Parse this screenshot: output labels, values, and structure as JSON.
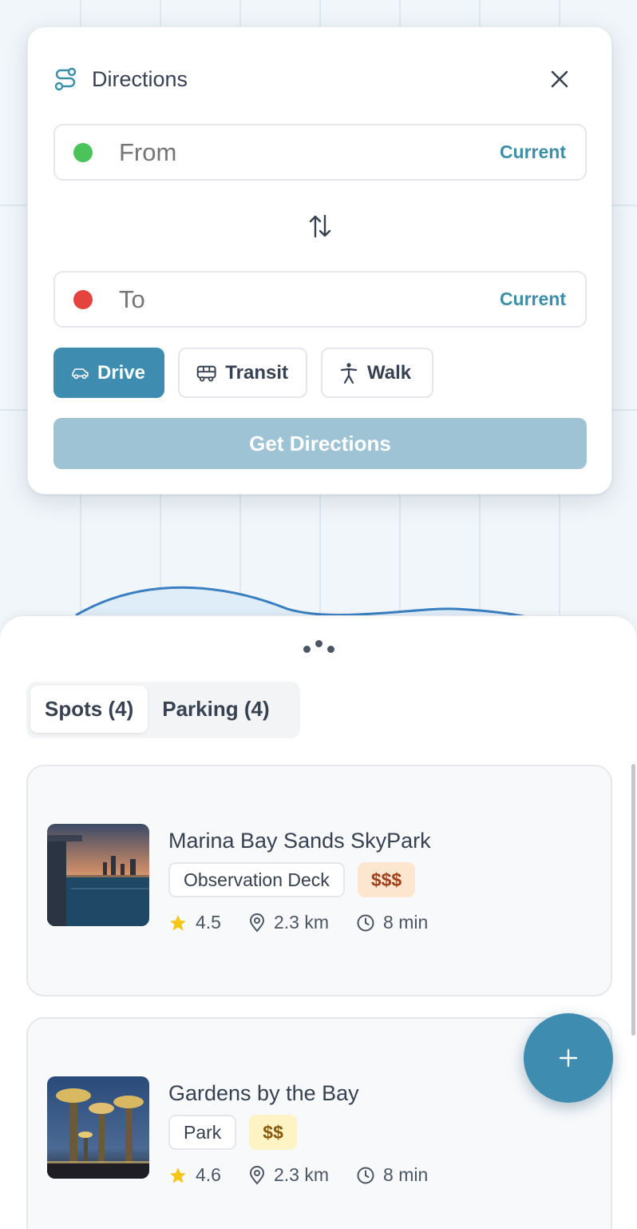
{
  "directions": {
    "title": "Directions",
    "from": {
      "placeholder": "From",
      "current_label": "Current",
      "dot_color": "#4cc35a"
    },
    "to": {
      "placeholder": "To",
      "current_label": "Current",
      "dot_color": "#e5443e"
    },
    "modes": [
      {
        "label": "Drive",
        "icon": "car-icon",
        "active": true
      },
      {
        "label": "Transit",
        "icon": "bus-icon",
        "active": false
      },
      {
        "label": "Walk",
        "icon": "walk-icon",
        "active": false
      }
    ],
    "get_directions_label": "Get Directions"
  },
  "sheet": {
    "tabs": [
      {
        "label": "Spots (4)",
        "active": true
      },
      {
        "label": "Parking (4)",
        "active": false
      }
    ],
    "spots": [
      {
        "name": "Marina Bay Sands SkyPark",
        "category": "Observation Deck",
        "price": "$$$",
        "price_bg": "#fde6d0",
        "price_color": "#a0401a",
        "rating": "4.5",
        "distance": "2.3 km",
        "time": "8 min"
      },
      {
        "name": "Gardens by the Bay",
        "category": "Park",
        "price": "$$",
        "price_bg": "#fdf3c4",
        "price_color": "#8a5a0a",
        "rating": "4.6",
        "distance": "2.3 km",
        "time": "8 min"
      }
    ]
  },
  "colors": {
    "accent": "#3e8cb0",
    "star": "#f5c518"
  }
}
